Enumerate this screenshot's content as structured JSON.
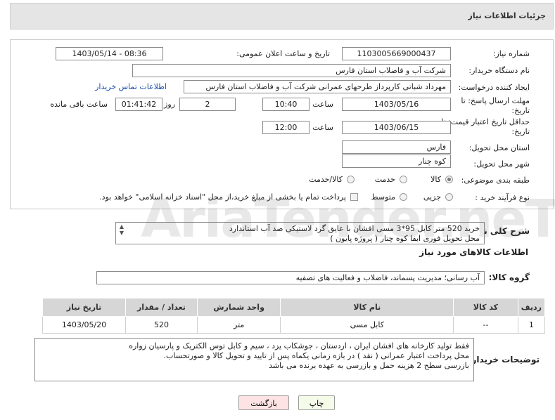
{
  "header": {
    "title": "جزئیات اطلاعات نیاز"
  },
  "form": {
    "need_number_label": "شماره نیاز:",
    "need_number": "1103005669000437",
    "announce_label": "تاریخ و ساعت اعلان عمومی:",
    "announce_value": "1403/05/14 - 08:36",
    "buyer_org_label": "نام دستگاه خریدار:",
    "buyer_org": "شرکت آب و فاضلاب استان فارس",
    "creator_label": "ایجاد کننده درخواست:",
    "creator": "مهرداد شبانی کارپرداز طرحهای عمرانی  شرکت آب و فاضلاب استان فارس",
    "contact_link": "اطلاعات تماس خریدار",
    "deadline_label_1": "مهلت ارسال پاسخ: تا",
    "deadline_label_2": "تاریخ:",
    "deadline_date": "1403/05/16",
    "time_label": "ساعت",
    "deadline_time": "10:40",
    "days_value": "2",
    "days_label": "روز و",
    "remaining_time": "01:41:42",
    "remaining_label": "ساعت باقی مانده",
    "validity_label_1": "حداقل تاریخ اعتبار قیمت: تا",
    "validity_label_2": "تاریخ:",
    "validity_date": "1403/06/15",
    "validity_time_label": "ساعت",
    "validity_time": "12:00",
    "province_label": "استان محل تحویل:",
    "province": "فارس",
    "city_label": "شهر محل تحویل:",
    "city": "کوه چنار",
    "category_label": "طبقه بندی موضوعی:",
    "category_options": [
      "کالا",
      "خدمت",
      "کالا/خدمت"
    ],
    "category_selected": "کالا",
    "process_label": "نوع فرآیند خرید :",
    "process_options": [
      "جزیی",
      "متوسط"
    ],
    "process_selected": "جزیی",
    "payment_text": "پرداخت تمام یا بخشی از مبلغ خرید،از محل \"اسناد خزانه اسلامی\" خواهد بود."
  },
  "description": {
    "label": "شرح کلی نیاز:",
    "line1": "خرید 520 متر کابل 95*3 مسی افشان با عایق گرد لاستیکی ضد آب استاندارد",
    "line2": "محل تحویل فوری ابفا کوه چنار ( پروژه پایون )"
  },
  "goods": {
    "section_title": "اطلاعات کالاهای مورد نیاز",
    "group_label": "گروه کالا:",
    "group_value": "آب رسانی؛ مدیریت پسماند، فاضلاب و فعالیت های تصفیه",
    "columns": [
      "ردیف",
      "کد کالا",
      "نام کالا",
      "واحد شمارش",
      "تعداد / مقدار",
      "تاریخ نیاز"
    ],
    "rows": [
      {
        "row": "1",
        "code": "--",
        "name": "کابل مسی",
        "unit": "متر",
        "qty": "520",
        "date": "1403/05/20"
      }
    ]
  },
  "buyer_notes": {
    "label": "توضیحات خریدار:",
    "line1": "فقط تولید کارخانه های افشان ایران ، اردستان ، جوشکاب یزد ، سیم و کابل توس الکتریک و پارسیان زواره",
    "line2": "محل پرداخت اعتبار عمرانی ( نقد ) در بازه زمانی یکماه  پس از تایید و تحویل کالا و صورتحساب.",
    "line3": "بازرسی سطح 2 هزینه حمل و بازرسی به عهده برنده می باشد"
  },
  "buttons": {
    "print": "چاپ",
    "back": "بازگشت"
  },
  "watermark_text": "AriaTender.neT",
  "colors": {
    "header_bg": "#e5e5e5",
    "link": "#1a4fa8",
    "back_button_bg": "#fde3e3",
    "print_button_bg": "#f4fbe9"
  }
}
